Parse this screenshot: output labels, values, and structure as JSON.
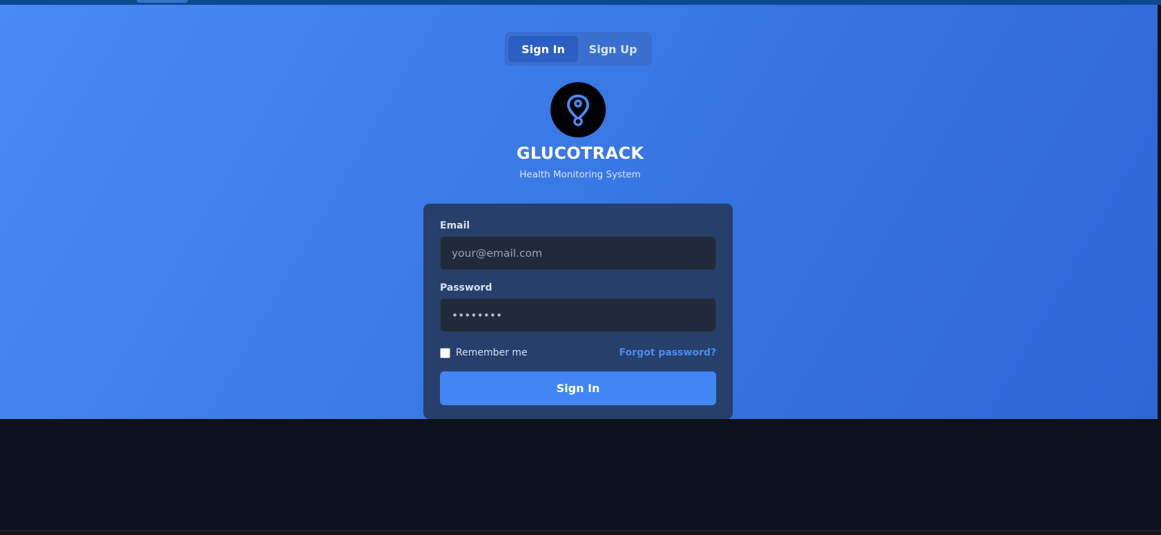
{
  "auth_tabs": {
    "sign_in": "Sign In",
    "sign_up": "Sign Up",
    "active": "sign_in"
  },
  "brand": {
    "title": "GLUCOTRACK",
    "subtitle": "Health Monitoring System",
    "logo_icon": "glucose-drop-icon"
  },
  "form": {
    "email": {
      "label": "Email",
      "placeholder": "your@email.com",
      "value": ""
    },
    "password": {
      "label": "Password",
      "value": "••••••••"
    },
    "remember_label": "Remember me",
    "remember_checked": false,
    "forgot_label": "Forgot password?",
    "submit_label": "Sign In"
  },
  "colors": {
    "hero_start": "#4a89f6",
    "hero_end": "#2e66d6",
    "card": "#263f6b",
    "input": "#212a3a",
    "accent": "#4285f4",
    "page_bg": "#0d111b"
  }
}
